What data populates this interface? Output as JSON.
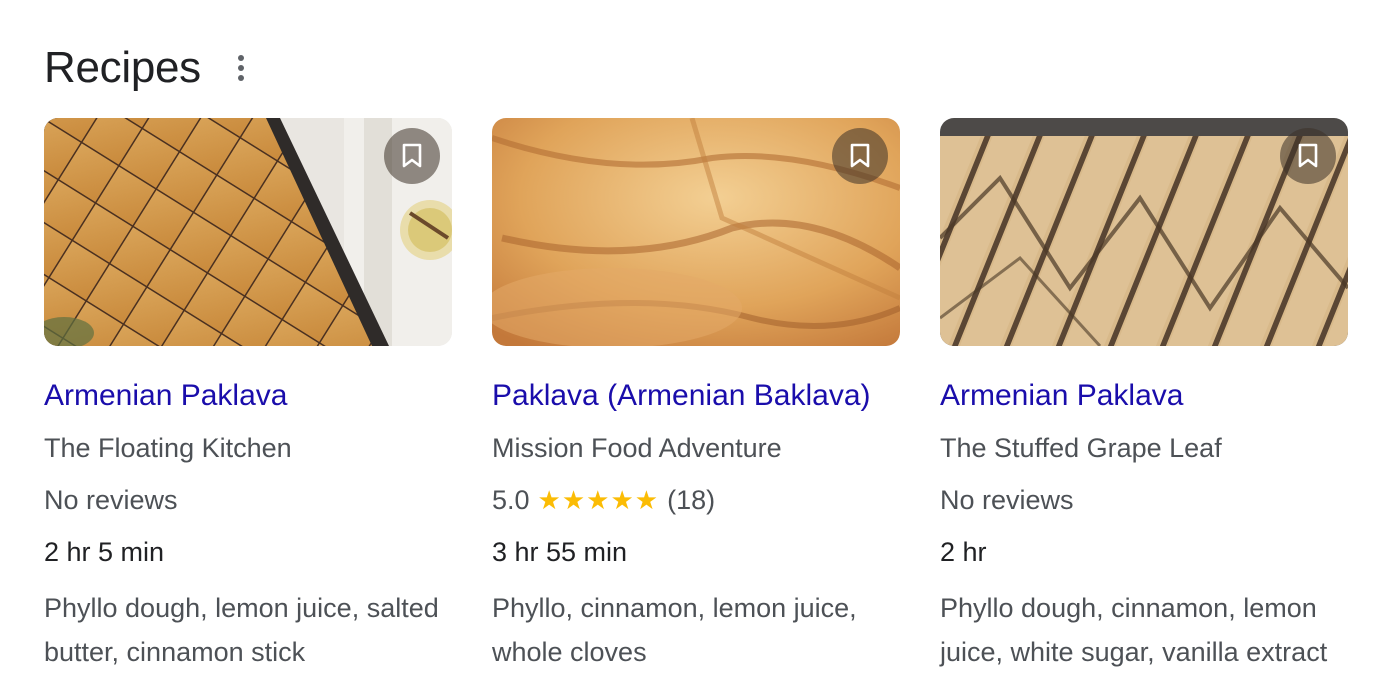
{
  "section": {
    "title": "Recipes"
  },
  "cards": [
    {
      "title": "Armenian Paklava",
      "source": "The Floating Kitchen",
      "reviews_text": "No reviews",
      "time": "2 hr 5 min",
      "ingredients": "Phyllo dough, lemon juice, salted butter, cinnamon stick",
      "image_icon": "baklava-tray-photo"
    },
    {
      "title": "Paklava (Armenian Baklava)",
      "source": "Mission Food Adventure",
      "rating": "5.0",
      "stars": "★★★★★",
      "rating_count": "(18)",
      "time": "3 hr 55 min",
      "ingredients": "Phyllo, cinnamon, lemon juice, whole cloves",
      "image_icon": "baklava-pastry-photo"
    },
    {
      "title": "Armenian Paklava",
      "source": "The Stuffed Grape Leaf",
      "reviews_text": "No reviews",
      "time": "2 hr",
      "ingredients": "Phyllo dough, cinnamon, lemon juice, white sugar, vanilla extract",
      "image_icon": "baklava-slices-photo"
    }
  ],
  "colors": {
    "link": "#1a0dab",
    "text": "#4d5156",
    "star": "#fbbc04"
  }
}
